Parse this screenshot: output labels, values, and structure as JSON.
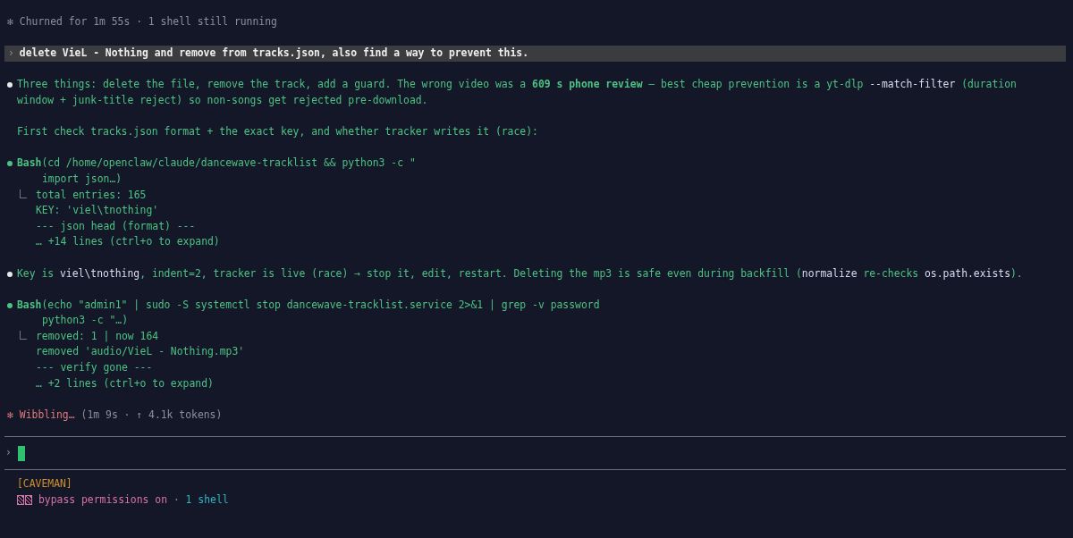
{
  "status": {
    "icon": "✻",
    "text": "Churned for 1m 55s · 1 shell still running"
  },
  "user_message": {
    "prompt": "›",
    "text": "delete VieL - Nothing and remove from tracks.json, also find a way to prevent this."
  },
  "transcript": [
    {
      "kind": "message",
      "segments": [
        {
          "kind": "plain",
          "text": "Three things: delete the file, remove the track, add a guard. The wrong video was a "
        },
        {
          "kind": "bold",
          "text": "609 s phone review"
        },
        {
          "kind": "plain",
          "text": " — best cheap prevention is a yt-dlp "
        },
        {
          "kind": "code",
          "text": "--match-filter"
        },
        {
          "kind": "plain",
          "text": " (duration window + junk-title reject) so non-songs get rejected pre-download."
        }
      ]
    },
    {
      "kind": "text",
      "segments": [
        {
          "kind": "plain",
          "text": "First check tracks.json format + the exact key, and whether tracker writes it (race):"
        }
      ]
    },
    {
      "kind": "tool",
      "tool": "Bash",
      "command": "(cd /home/openclaw/claude/dancewave-tracklist && python3 -c \"",
      "command_continued": "import json…)",
      "output": [
        "total entries: 165",
        "KEY: 'viel\\tnothing'",
        "--- json head (format) ---",
        "… +14 lines (ctrl+o to expand)"
      ]
    },
    {
      "kind": "message",
      "segments": [
        {
          "kind": "plain",
          "text": "Key is "
        },
        {
          "kind": "code",
          "text": "viel\\tnothing"
        },
        {
          "kind": "plain",
          "text": ", indent=2, tracker is live (race) → stop it, edit, restart. Deleting the mp3 is safe even during backfill ("
        },
        {
          "kind": "code",
          "text": "normalize"
        },
        {
          "kind": "plain",
          "text": " re-checks "
        },
        {
          "kind": "code",
          "text": "os.path.exists"
        },
        {
          "kind": "plain",
          "text": ")."
        }
      ]
    },
    {
      "kind": "tool",
      "tool": "Bash",
      "command": "(echo \"admin1\" | sudo -S systemctl stop dancewave-tracklist.service 2>&1 | grep -v password",
      "command_continued": "python3 -c \"…)",
      "output": [
        "removed: 1 | now 164",
        "removed 'audio/VieL - Nothing.mp3'",
        "--- verify gone ---",
        "… +2 lines (ctrl+o to expand)"
      ]
    }
  ],
  "spinner": {
    "icon": "✻",
    "verb": "Wibbling…",
    "detail": "(1m 9s · ↑ 4.1k tokens)"
  },
  "input": {
    "prompt": "›"
  },
  "footer": {
    "mode": "[CAVEMAN]",
    "permissions": "bypass permissions on",
    "separator": "·",
    "shells": "1 shell"
  }
}
